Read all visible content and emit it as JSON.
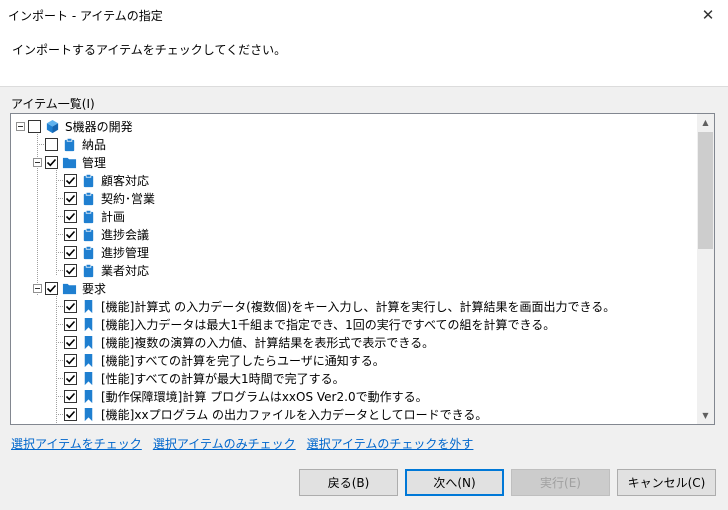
{
  "window": {
    "title": "インポート - アイテムの指定",
    "close_glyph": "✕"
  },
  "instruction": "インポートするアイテムをチェックしてください。",
  "group_label": "アイテム一覧(I)",
  "tree": [
    {
      "label": "S機器の開発",
      "level": 0,
      "checked": false,
      "expander": true,
      "icon": "project-cube-icon"
    },
    {
      "label": "納品",
      "level": 1,
      "checked": false,
      "expander": false,
      "icon": "clipboard-icon"
    },
    {
      "label": "管理",
      "level": 1,
      "checked": true,
      "expander": true,
      "icon": "folder-icon"
    },
    {
      "label": "顧客対応",
      "level": 2,
      "checked": true,
      "expander": false,
      "icon": "clipboard-icon"
    },
    {
      "label": "契約･営業",
      "level": 2,
      "checked": true,
      "expander": false,
      "icon": "clipboard-icon"
    },
    {
      "label": "計画",
      "level": 2,
      "checked": true,
      "expander": false,
      "icon": "clipboard-icon"
    },
    {
      "label": "進捗会議",
      "level": 2,
      "checked": true,
      "expander": false,
      "icon": "clipboard-icon"
    },
    {
      "label": "進捗管理",
      "level": 2,
      "checked": true,
      "expander": false,
      "icon": "clipboard-icon"
    },
    {
      "label": "業者対応",
      "level": 2,
      "checked": true,
      "expander": false,
      "icon": "clipboard-icon"
    },
    {
      "label": "要求",
      "level": 1,
      "checked": true,
      "expander": true,
      "icon": "folder-icon"
    },
    {
      "label": "[機能]計算式 の入力データ(複数個)をキー入力し、計算を実行し、計算結果を画面出力できる。",
      "level": 2,
      "checked": true,
      "expander": false,
      "icon": "bookmark-icon"
    },
    {
      "label": "[機能]入力データは最大1千組まで指定でき、1回の実行ですべての組を計算できる。",
      "level": 2,
      "checked": true,
      "expander": false,
      "icon": "bookmark-icon"
    },
    {
      "label": "[機能]複数の演算の入力値、計算結果を表形式で表示できる。",
      "level": 2,
      "checked": true,
      "expander": false,
      "icon": "bookmark-icon"
    },
    {
      "label": "[機能]すべての計算を完了したらユーザに通知する。",
      "level": 2,
      "checked": true,
      "expander": false,
      "icon": "bookmark-icon"
    },
    {
      "label": "[性能]すべての計算が最大1時間で完了する。",
      "level": 2,
      "checked": true,
      "expander": false,
      "icon": "bookmark-icon"
    },
    {
      "label": "[動作保障環境]計算 プログラムはxxOS  Ver2.0で動作する。",
      "level": 2,
      "checked": true,
      "expander": false,
      "icon": "bookmark-icon"
    },
    {
      "label": "[機能]xxプログラム の出力ファイルを入力データとしてロードできる。",
      "level": 2,
      "checked": true,
      "expander": false,
      "icon": "bookmark-icon"
    }
  ],
  "links": [
    "選択アイテムをチェック",
    "選択アイテムのみチェック",
    "選択アイテムのチェックを外す"
  ],
  "buttons": {
    "back": "戻る(B)",
    "next": "次へ(N)",
    "run": "実行(E)",
    "cancel": "キャンセル(C)"
  },
  "colors": {
    "icon_blue": "#1f7fd0",
    "link": "#0066cc",
    "accent": "#0078d7"
  }
}
